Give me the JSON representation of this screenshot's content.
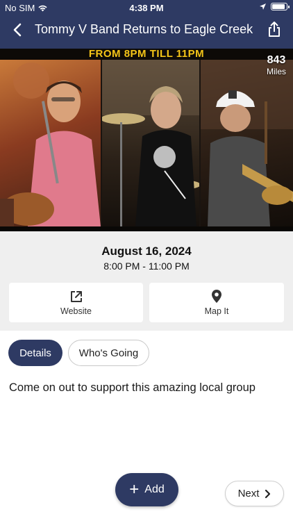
{
  "status_bar": {
    "carrier": "No SIM",
    "time": "4:38 PM"
  },
  "nav": {
    "title": "Tommy V Band Returns to Eagle Creek",
    "back_icon": "chevron-left-icon",
    "share_icon": "share-icon"
  },
  "hero": {
    "banner_text": "FROM 8PM TILL 11PM",
    "distance_value": "843",
    "distance_unit": "Miles"
  },
  "event": {
    "date": "August 16, 2024",
    "time_range": "8:00 PM - 11:00 PM"
  },
  "actions": {
    "website_label": "Website",
    "website_icon": "external-link-icon",
    "map_label": "Map It",
    "map_icon": "map-pin-icon"
  },
  "tabs": [
    {
      "label": "Details",
      "active": true
    },
    {
      "label": "Who's Going",
      "active": false
    }
  ],
  "details": {
    "description": "Come on out to support this amazing local group"
  },
  "footer": {
    "add_label": "Add",
    "next_label": "Next"
  },
  "colors": {
    "primary": "#2e3a63",
    "section_bg": "#efefef",
    "banner_text": "#f5c518"
  }
}
